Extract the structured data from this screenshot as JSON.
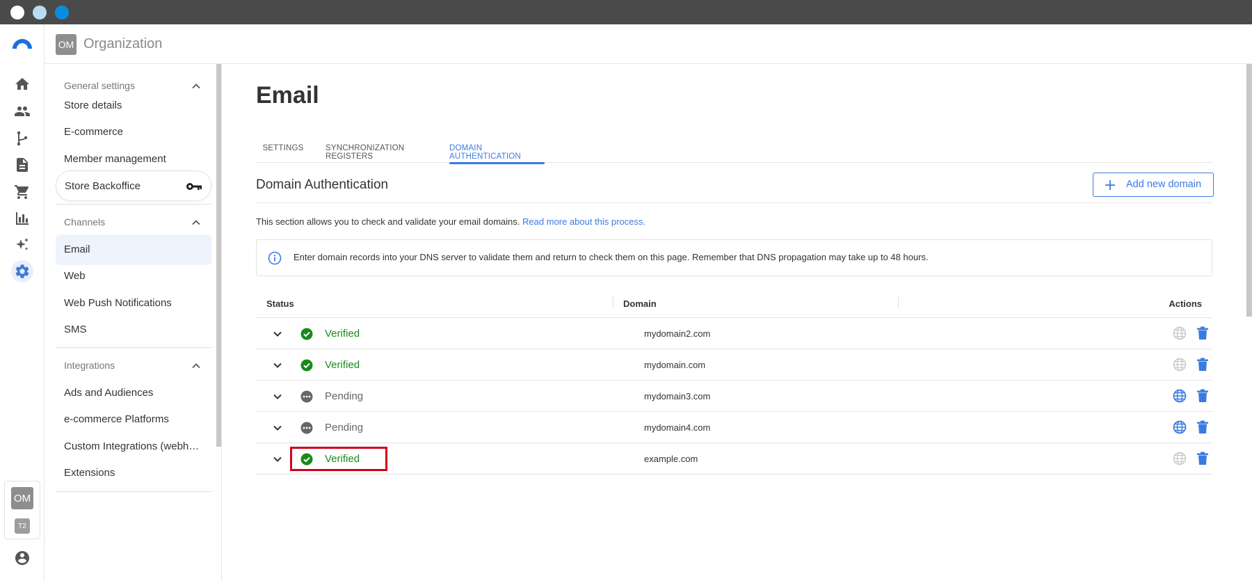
{
  "colors": {
    "accent": "#3a7be0",
    "verified": "#1a8a1a",
    "pending": "#666666",
    "highlight": "#d0021b",
    "titlebar": "#4a4a4a"
  },
  "window_controls": [
    "close",
    "minimize",
    "maximize"
  ],
  "rail": {
    "logo": "brand-arc-logo",
    "icons": [
      "home-icon",
      "people-icon",
      "flow-icon",
      "document-icon",
      "cart-icon",
      "bar-chart-icon",
      "sparkle-icon",
      "gear-icon"
    ],
    "active": "gear-icon",
    "user_badge": "OM",
    "tenant_badge": "T2",
    "account_icon": "account-circle-icon"
  },
  "topbar": {
    "org_badge": "OM",
    "org_name": "Organization"
  },
  "sidebar": {
    "general": {
      "title": "General settings",
      "items": [
        "Store details",
        "E-commerce",
        "Member management",
        "Store Backoffice"
      ]
    },
    "channels": {
      "title": "Channels",
      "items": [
        "Email",
        "Web",
        "Web Push Notifications",
        "SMS"
      ],
      "active": "Email"
    },
    "integrations": {
      "title": "Integrations",
      "items": [
        "Ads and Audiences",
        "e-commerce Platforms",
        "Custom Integrations (webhooks)",
        "Extensions"
      ]
    }
  },
  "main": {
    "title": "Email",
    "tabs": [
      "SETTINGS",
      "SYNCHRONIZATION REGISTERS",
      "DOMAIN AUTHENTICATION"
    ],
    "active_tab": "DOMAIN AUTHENTICATION",
    "section_title": "Domain Authentication",
    "add_button": "Add new domain",
    "description": "This section allows you to check and validate your email domains.",
    "description_link": "Read more about this process.",
    "info": "Enter domain records into your DNS server to validate them and return to check them on this page. Remember that DNS propagation may take up to 48 hours."
  },
  "table": {
    "headers": {
      "status": "Status",
      "domain": "Domain",
      "actions": "Actions"
    },
    "rows": [
      {
        "status": "Verified",
        "domain": "mydomain2.com"
      },
      {
        "status": "Verified",
        "domain": "mydomain.com"
      },
      {
        "status": "Pending",
        "domain": "mydomain3.com"
      },
      {
        "status": "Pending",
        "domain": "mydomain4.com"
      },
      {
        "status": "Verified",
        "domain": "example.com"
      }
    ]
  }
}
